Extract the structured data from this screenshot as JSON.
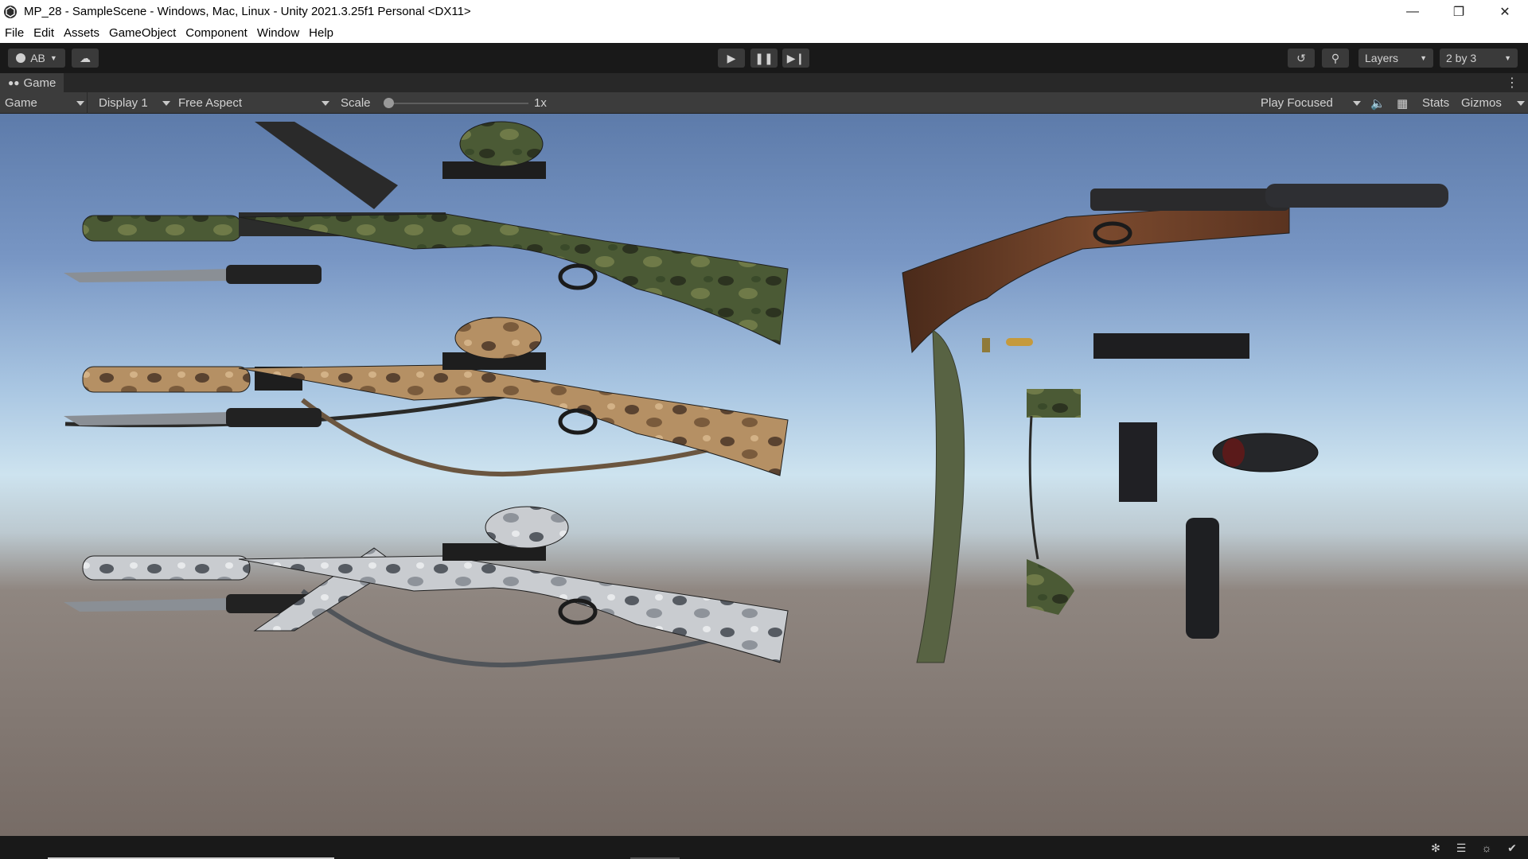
{
  "window": {
    "title": "MP_28 - SampleScene - Windows, Mac, Linux - Unity 2021.3.25f1 Personal <DX11>",
    "minimize_icon": "minimize-icon",
    "maximize_icon": "restore-icon",
    "close_icon": "close-icon"
  },
  "menu": {
    "items": [
      "File",
      "Edit",
      "Assets",
      "GameObject",
      "Component",
      "Window",
      "Help"
    ]
  },
  "toolbar": {
    "account_label": "AB",
    "layers_label": "Layers",
    "layout_label": "2 by 3"
  },
  "tab": {
    "label": "Game"
  },
  "game_toolbar": {
    "mode": "Game",
    "display": "Display 1",
    "aspect": "Free Aspect",
    "scale_label": "Scale",
    "scale_value": "1x",
    "scale_fraction": 0.0,
    "play_focused": "Play Focused",
    "stats": "Stats",
    "gizmos": "Gizmos"
  },
  "colors": {
    "editor_dark": "#191919",
    "panel": "#3c3c3c",
    "sky_top": "#5d7baa",
    "horizon": "#cde3ef",
    "ground": "#776c66",
    "camo_green": "#4a5a35",
    "camo_desert": "#b08d62",
    "camo_snow": "#c9ccd0",
    "wood": "#6e3f26"
  }
}
